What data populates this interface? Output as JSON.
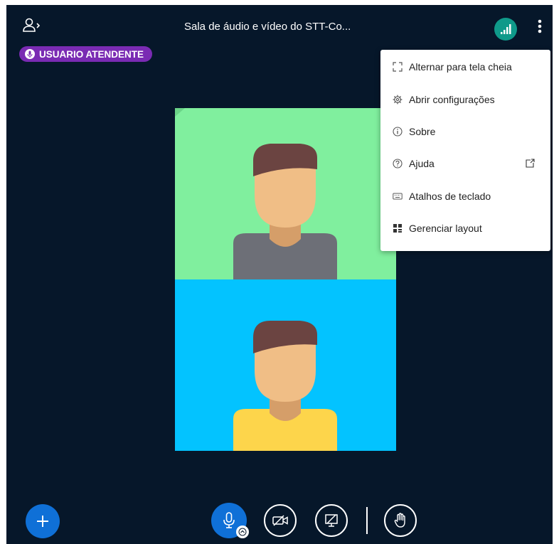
{
  "header": {
    "title": "Sala de áudio e vídeo do STT-Co..."
  },
  "talking_indicator": {
    "name": "USUARIO ATENDENTE"
  },
  "options_menu": {
    "items": [
      {
        "label": "Alternar para tela cheia",
        "icon": "fullscreen-icon"
      },
      {
        "label": "Abrir configurações",
        "icon": "gear-icon"
      },
      {
        "label": "Sobre",
        "icon": "info-icon"
      },
      {
        "label": "Ajuda",
        "icon": "help-icon",
        "trailing_icon": "external-link-icon"
      },
      {
        "label": "Atalhos de teclado",
        "icon": "keyboard-icon"
      },
      {
        "label": "Gerenciar layout",
        "icon": "layout-icon"
      }
    ]
  },
  "colors": {
    "background": "#06172a",
    "primary": "#0f70d7",
    "connection": "#0f9a8a",
    "talking_badge": "#7a2bb3",
    "tile_1": "#80ef9e",
    "tile_2": "#03c3ff"
  }
}
